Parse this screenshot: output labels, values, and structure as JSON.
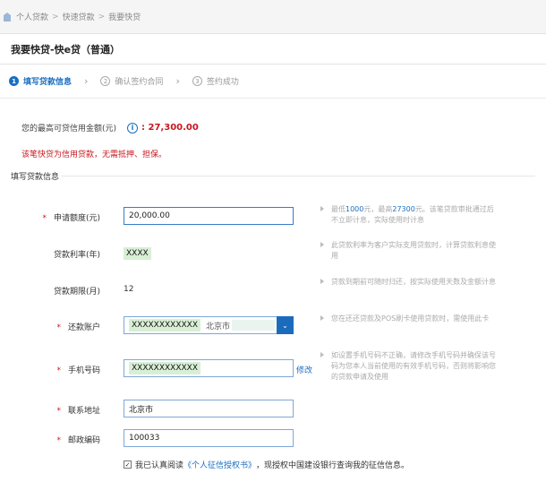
{
  "breadcrumb": {
    "items": [
      "个人贷款",
      "快速贷款",
      "我要快贷"
    ],
    "separator": ">"
  },
  "page_title": "我要快贷-快e贷（普通）",
  "steps": [
    {
      "num": "1",
      "label": "填写贷款信息",
      "active": true
    },
    {
      "num": "2",
      "label": "确认签约合同",
      "active": false
    },
    {
      "num": "3",
      "label": "签约成功",
      "active": false
    }
  ],
  "limit": {
    "label": "您的最高可贷信用金额(元)",
    "icon": "i",
    "amount": "27,300.00"
  },
  "warning": "该笔快贷为信用贷款，无需抵押、担保。",
  "section_title": "填写贷款信息",
  "form": {
    "amount": {
      "label": "申请额度(元)",
      "value": "20,000.00",
      "hint_pre": "最低",
      "hint_min": "1000",
      "hint_mid": "元，最高",
      "hint_max": "27300",
      "hint_post": "元。该笔贷款审批通过后不立即计息，实际使用时计息"
    },
    "rate": {
      "label": "贷款利率(年)",
      "value": "XXXX",
      "hint": "此贷款利率为客户实际支用贷款时，计算贷款利息使用"
    },
    "term": {
      "label": "贷款期限(月)",
      "value": "12",
      "hint": "贷款到期前可随时归还，按实际使用天数及金额计息"
    },
    "account": {
      "label": "还款账户",
      "value": "XXXXXXXXXXXX",
      "city": "北京市",
      "hint": "您在还还贷款及POS刷卡使用贷款时，需使用此卡"
    },
    "phone": {
      "label": "手机号码",
      "value": "XXXXXXXXXXXX",
      "modify": "修改",
      "hint": "如设置手机号码不正确，请修改手机号码并确保该号码为您本人当前使用的有效手机号码，否则将影响您的贷款申请及使用"
    },
    "address": {
      "label": "联系地址",
      "value": "北京市"
    },
    "postcode": {
      "label": "邮政编码",
      "value": "100033"
    }
  },
  "agreement": {
    "checked": "✓",
    "pre": "我已认真阅读",
    "link": "《个人征信授权书》",
    "post": "，现授权中国建设银行查询我的征信信息。"
  },
  "colors": {
    "accent": "#1a6fc1",
    "danger": "#c8161d",
    "mask": "#d8efd6"
  }
}
